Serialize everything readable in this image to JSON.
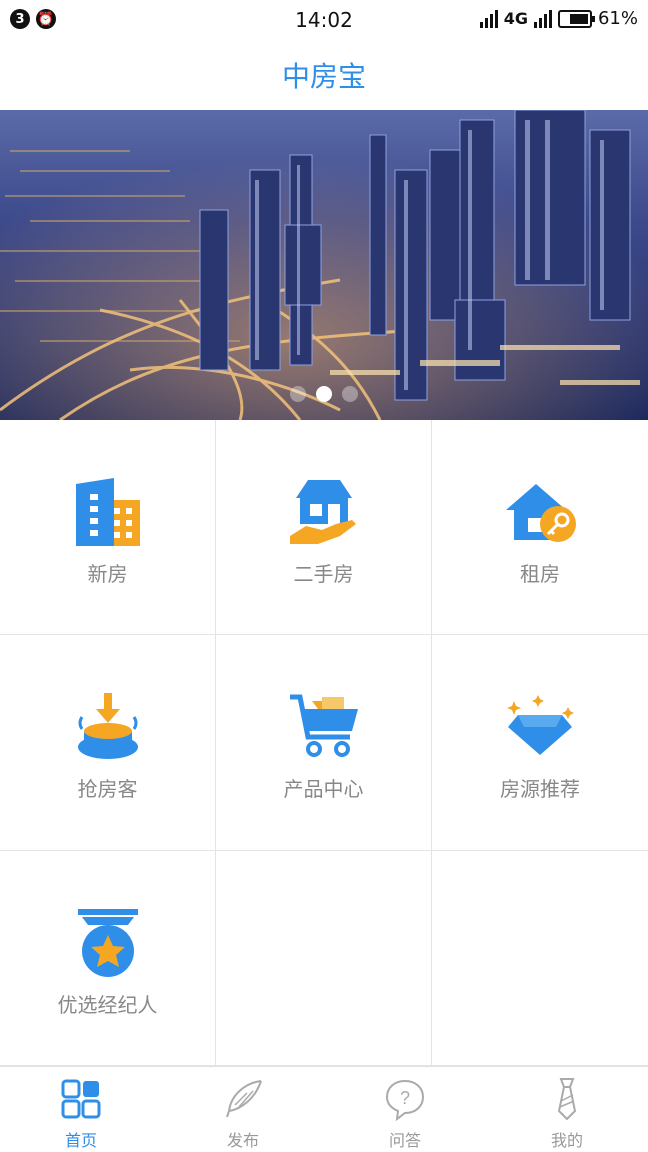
{
  "status_bar": {
    "notification_count": "3",
    "time": "14:02",
    "network": "4G",
    "battery": "61%"
  },
  "header": {
    "title": "中房宝"
  },
  "banner": {
    "slide_count": 3,
    "active_slide": 2
  },
  "colors": {
    "accent": "#2f8fe8",
    "orange": "#f5a623",
    "muted_text": "#888888"
  },
  "menu": {
    "items": [
      {
        "label": "新房",
        "icon": "building-icon"
      },
      {
        "label": "二手房",
        "icon": "house-hand-icon"
      },
      {
        "label": "租房",
        "icon": "house-key-icon"
      },
      {
        "label": "抢房客",
        "icon": "grab-button-icon"
      },
      {
        "label": "产品中心",
        "icon": "cart-icon"
      },
      {
        "label": "房源推荐",
        "icon": "diamond-icon"
      },
      {
        "label": "优选经纪人",
        "icon": "medal-icon"
      }
    ]
  },
  "tabbar": {
    "tabs": [
      {
        "label": "首页",
        "icon": "home-grid-icon",
        "active": true
      },
      {
        "label": "发布",
        "icon": "feather-icon",
        "active": false
      },
      {
        "label": "问答",
        "icon": "question-bubble-icon",
        "active": false
      },
      {
        "label": "我的",
        "icon": "tie-icon",
        "active": false
      }
    ]
  }
}
